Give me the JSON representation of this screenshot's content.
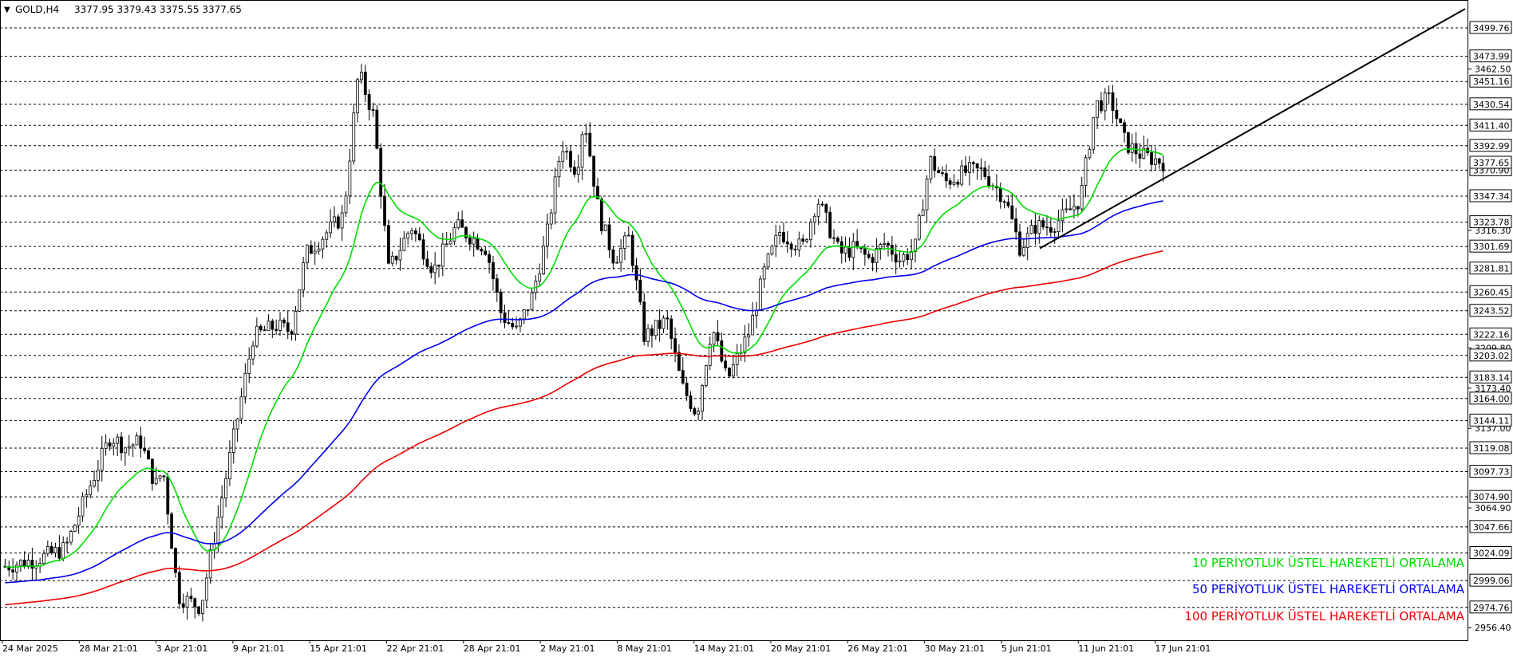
{
  "header": {
    "symbol": "GOLD,H4",
    "ohlc": "3377.95 3379.43 3375.55 3377.65"
  },
  "legend": [
    {
      "label": "10 PERİYOTLUK ÜSTEL HAREKETLİ ORTALAMA",
      "color": "#00dd00"
    },
    {
      "label": "50 PERİYOTLUK ÜSTEL HAREKETLİ ORTALAMA",
      "color": "#0000ee"
    },
    {
      "label": "100 PERİYOTLUK ÜSTEL HAREKETLİ ORTALAMA",
      "color": "#ee0000"
    }
  ],
  "colors": {
    "candle": "#000000",
    "grid": "#000000",
    "ema10": "#00dd00",
    "ema50": "#0000ee",
    "ema100": "#ee0000",
    "trendline": "#000000",
    "background": "#ffffff"
  },
  "chart_data": {
    "type": "line",
    "subtype": "candlestick",
    "timeframe": "H4",
    "x_labels": [
      "24 Mar 2025",
      "28 Mar 21:01",
      "3 Apr 21:01",
      "9 Apr 21:01",
      "15 Apr 21:01",
      "22 Apr 21:01",
      "28 Apr 21:01",
      "2 May 21:01",
      "8 May 21:01",
      "14 May 21:01",
      "20 May 21:01",
      "26 May 21:01",
      "30 May 21:01",
      "5 Jun 21:01",
      "11 Jun 21:01",
      "17 Jun 21:01"
    ],
    "ylim": [
      2945,
      3525
    ],
    "horizontal_levels": [
      3499.76,
      3473.99,
      3451.16,
      3430.54,
      3411.4,
      3392.99,
      3370.9,
      3347.34,
      3323.78,
      3301.69,
      3281.81,
      3260.45,
      3243.52,
      3222.16,
      3203.02,
      3183.14,
      3164.0,
      3144.11,
      3119.08,
      3097.73,
      3074.9,
      3047.66,
      3024.09,
      2999.06,
      2974.76
    ],
    "labeled_levels": [
      3499.76,
      3473.99,
      3451.16,
      3430.54,
      3411.4,
      3392.99,
      3370.9,
      3347.34,
      3323.78,
      3301.69,
      3281.81,
      3260.45,
      3243.52,
      3222.16,
      3203.02,
      3183.14,
      3164.0,
      3144.11,
      3119.08,
      3097.73,
      3074.9,
      3047.66,
      3024.09,
      2999.06,
      2974.76
    ],
    "tick_labels": [
      3462.5,
      3316.3,
      3209.8,
      3173.4,
      3137.0,
      3064.9,
      2956.4
    ],
    "current_price": 3377.65,
    "price_path": [
      [
        0,
        3012
      ],
      [
        4,
        3018
      ],
      [
        8,
        3028
      ],
      [
        11,
        3080
      ],
      [
        14,
        3130
      ],
      [
        16,
        3120
      ],
      [
        18,
        3125
      ],
      [
        20,
        3085
      ],
      [
        21,
        3100
      ],
      [
        23,
        2985
      ],
      [
        26,
        2975
      ],
      [
        27,
        3010
      ],
      [
        29,
        3080
      ],
      [
        33,
        3220
      ],
      [
        36,
        3230
      ],
      [
        38,
        3225
      ],
      [
        40,
        3295
      ],
      [
        45,
        3330
      ],
      [
        47,
        3460
      ],
      [
        49,
        3420
      ],
      [
        51,
        3280
      ],
      [
        54,
        3320
      ],
      [
        57,
        3280
      ],
      [
        60,
        3320
      ],
      [
        62,
        3310
      ],
      [
        64,
        3300
      ],
      [
        66,
        3240
      ],
      [
        68,
        3225
      ],
      [
        70,
        3255
      ],
      [
        72,
        3310
      ],
      [
        74,
        3395
      ],
      [
        76,
        3370
      ],
      [
        77,
        3420
      ],
      [
        79,
        3330
      ],
      [
        81,
        3290
      ],
      [
        83,
        3310
      ],
      [
        85,
        3220
      ],
      [
        88,
        3235
      ],
      [
        90,
        3175
      ],
      [
        92,
        3150
      ],
      [
        94,
        3230
      ],
      [
        96,
        3180
      ],
      [
        99,
        3225
      ],
      [
        101,
        3280
      ],
      [
        103,
        3315
      ],
      [
        106,
        3300
      ],
      [
        108,
        3345
      ],
      [
        111,
        3295
      ],
      [
        113,
        3300
      ],
      [
        115,
        3290
      ],
      [
        117,
        3305
      ],
      [
        119,
        3290
      ],
      [
        121,
        3300
      ],
      [
        123,
        3380
      ],
      [
        125,
        3360
      ],
      [
        128,
        3370
      ],
      [
        130,
        3370
      ],
      [
        133,
        3345
      ],
      [
        135,
        3300
      ],
      [
        137,
        3320
      ],
      [
        139,
        3320
      ],
      [
        141,
        3330
      ],
      [
        143,
        3345
      ],
      [
        145,
        3430
      ],
      [
        147,
        3435
      ],
      [
        149,
        3395
      ],
      [
        151,
        3385
      ],
      [
        154,
        3378
      ]
    ],
    "trendline": {
      "from": [
        "5 Jun",
        3300
      ],
      "to": [
        "beyond 17 Jun",
        3510
      ]
    },
    "series": [
      {
        "name": "10 PERİYOTLUK ÜSTEL HAREKETLİ ORTALAMA",
        "period": 10,
        "color": "#00dd00"
      },
      {
        "name": "50 PERİYOTLUK ÜSTEL HAREKETLİ ORTALAMA",
        "period": 50,
        "color": "#0000ee"
      },
      {
        "name": "100 PERİYOTLUK ÜSTEL HAREKETLİ ORTALAMA",
        "period": 100,
        "color": "#ee0000"
      }
    ],
    "grid": true,
    "legend_position": "bottom-right"
  }
}
